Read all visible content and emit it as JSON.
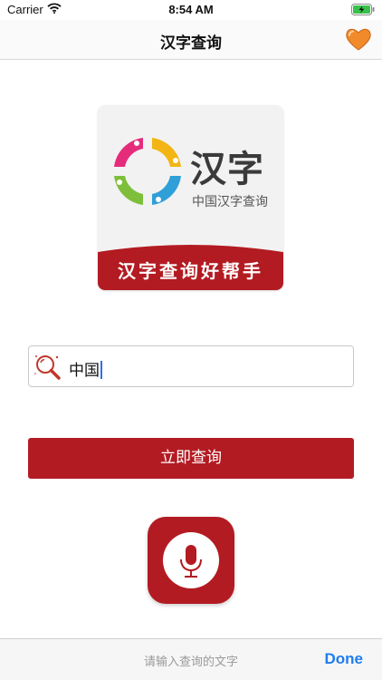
{
  "status_bar": {
    "carrier": "Carrier",
    "time": "8:54 AM",
    "icons": [
      "wifi-icon",
      "battery-charging-icon"
    ]
  },
  "nav": {
    "title": "汉字查询",
    "right_icon": "heart-icon",
    "heart_color": "#f08a2a"
  },
  "logo": {
    "title": "汉字",
    "subtitle": "中国汉字查询",
    "slogan": "汉字查询好帮手",
    "banner_color": "#b31b22"
  },
  "search": {
    "value": "中国",
    "icon": "search-icon"
  },
  "actions": {
    "query_label": "立即查询",
    "mic_icon": "microphone-icon",
    "accent_color": "#b31b22"
  },
  "keyboard_toolbar": {
    "placeholder": "请输入查询的文字",
    "done_label": "Done",
    "done_color": "#1e7cf0"
  }
}
